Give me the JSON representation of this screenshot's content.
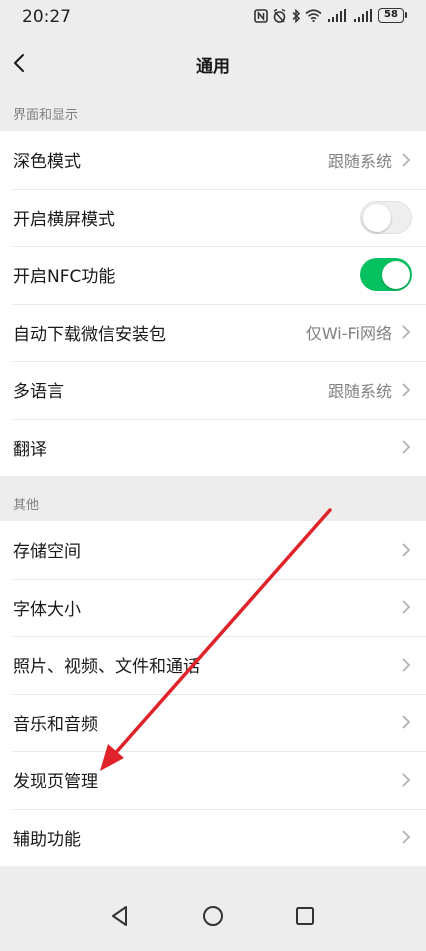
{
  "status_bar": {
    "time": "20:27",
    "battery": "58"
  },
  "nav": {
    "title": "通用"
  },
  "section_display": {
    "header": "界面和显示",
    "rows": [
      {
        "label": "深色模式",
        "value": "跟随系统"
      },
      {
        "label": "开启横屏模式",
        "toggle": "off"
      },
      {
        "label": "开启NFC功能",
        "toggle": "on"
      },
      {
        "label": "自动下载微信安装包",
        "value": "仅Wi-Fi网络"
      },
      {
        "label": "多语言",
        "value": "跟随系统"
      },
      {
        "label": "翻译",
        "value": ""
      }
    ]
  },
  "section_other": {
    "header": "其他",
    "rows": [
      {
        "label": "存储空间"
      },
      {
        "label": "字体大小"
      },
      {
        "label": "照片、视频、文件和通话"
      },
      {
        "label": "音乐和音频"
      },
      {
        "label": "发现页管理"
      },
      {
        "label": "辅助功能"
      }
    ]
  },
  "colors": {
    "toggle_on": "#07c160",
    "annotation_arrow": "#e0222a"
  }
}
